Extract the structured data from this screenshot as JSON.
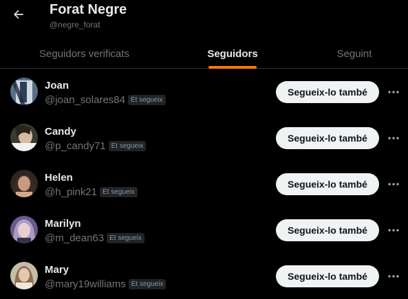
{
  "header": {
    "back_icon": "arrow-left-icon",
    "name": "Forat Negre",
    "handle": "@negre_forat"
  },
  "tabs": [
    {
      "label": "Seguidors verificats",
      "active": false
    },
    {
      "label": "Seguidors",
      "active": true
    },
    {
      "label": "Seguint",
      "active": false
    }
  ],
  "colors": {
    "accent": "#ff7a00",
    "background": "#000000",
    "button_bg": "#eff3f4"
  },
  "users": [
    {
      "name": "Joan",
      "handle": "@joan_solares84",
      "badge": "Et segueix",
      "button": "Segueix-lo també",
      "more_icon": "more-horizontal-icon"
    },
    {
      "name": "Candy",
      "handle": "@p_candy71",
      "badge": "Et segueix",
      "button": "Segueix-lo també",
      "more_icon": "more-horizontal-icon"
    },
    {
      "name": "Helen",
      "handle": "@h_pink21",
      "badge": "Et segueix",
      "button": "Segueix-lo també",
      "more_icon": "more-horizontal-icon"
    },
    {
      "name": "Marilyn",
      "handle": "@m_dean63",
      "badge": "Et segueix",
      "button": "Segueix-lo també",
      "more_icon": "more-horizontal-icon"
    },
    {
      "name": "Mary",
      "handle": "@mary19williams",
      "badge": "Et segueix",
      "button": "Segueix-lo també",
      "more_icon": "more-horizontal-icon"
    }
  ]
}
